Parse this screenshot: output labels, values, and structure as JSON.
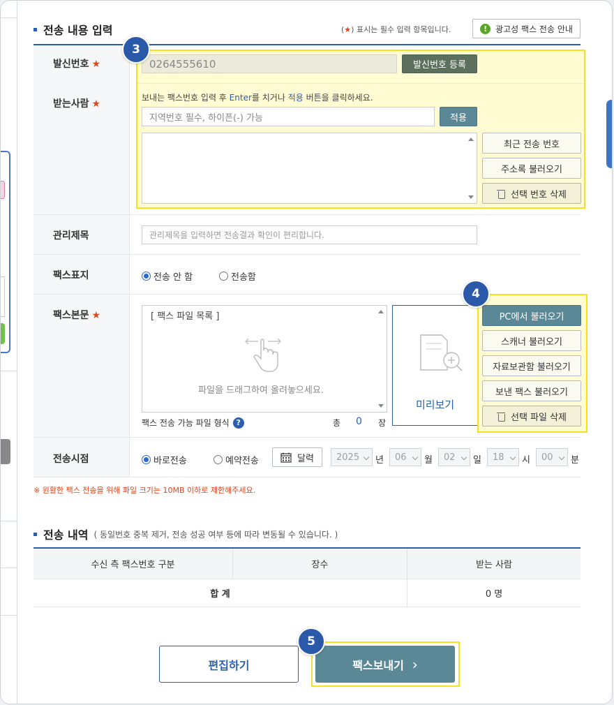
{
  "header": {
    "title": "전송 내용 입력",
    "required_note_prefix": "(",
    "required_star": "★",
    "required_note_text": ") 표시는 필수 입력 항목입니다.",
    "ad_fax_info_button": "광고성 팩스 전송 안내"
  },
  "steps": {
    "s3": "3",
    "s4": "4",
    "s5": "5"
  },
  "sender": {
    "label": "발신번호",
    "value": "0264555610",
    "register_button": "발신번호 등록"
  },
  "recipient": {
    "label": "받는사람",
    "helper_pre": "보내는 팩스번호 입력 후 ",
    "helper_enter": "Enter",
    "helper_mid": "를 치거나 ",
    "helper_apply": "적용",
    "helper_post": " 버튼을 클릭하세요.",
    "placeholder": "지역번호 필수, 하이픈(-) 가능",
    "apply_button": "적용",
    "recent_button": "최근 전송 번호",
    "addressbook_button": "주소록 불러오기",
    "delete_button": "선택 번호 삭제"
  },
  "manage_title": {
    "label": "관리제목",
    "placeholder": "관리제목을 입력하면 전송결과 확인이 편리합니다."
  },
  "cover": {
    "label": "팩스표지",
    "option_none": "전송 안 함",
    "option_send": "전송함",
    "selected": "전송 안 함"
  },
  "body": {
    "label": "팩스본문",
    "file_list_title": "[ 팩스 파일 목록 ]",
    "drop_hint": "파일을 드래그하여 올려놓으세요.",
    "preview_label": "미리보기",
    "formats_label": "팩스 전송 가능 파일 형식",
    "total_label": "총",
    "total_count": "0",
    "total_unit": "장",
    "pc_button": "PC에서 불러오기",
    "scanner_button": "스캐너 불러오기",
    "archive_button": "자료보관함 불러오기",
    "sent_button": "보낸 팩스 불러오기",
    "delete_button": "선택 파일 삭제"
  },
  "schedule": {
    "label": "전송시점",
    "option_now": "바로전송",
    "option_reserve": "예약전송",
    "selected": "바로전송",
    "calendar_button": "달력",
    "year": "2025",
    "year_unit": "년",
    "month": "06",
    "month_unit": "월",
    "day": "02",
    "day_unit": "일",
    "hour": "18",
    "hour_unit": "시",
    "minute": "00",
    "minute_unit": "분"
  },
  "notice": "※ 원활한 팩스 전송을 위해 파일 크기는 10MB 이하로 제한해주세요.",
  "history": {
    "title": "전송 내역",
    "subtitle": "( 동일번호 중복 제거, 전송 성공 여부 등에 따라 변동될 수 있습니다. )",
    "columns": [
      "수신 측 팩스번호 구분",
      "장수",
      "받는 사람"
    ],
    "total_label": "합 계",
    "total_recipients": "0 명"
  },
  "actions": {
    "edit_button": "편집하기",
    "send_button": "팩스보내기",
    "send_chevron": "›"
  },
  "colors": {
    "accent_blue": "#2b5fad",
    "highlight_yellow": "#f6e21c",
    "required_red": "#e0451c",
    "send_teal": "#5b8897"
  }
}
